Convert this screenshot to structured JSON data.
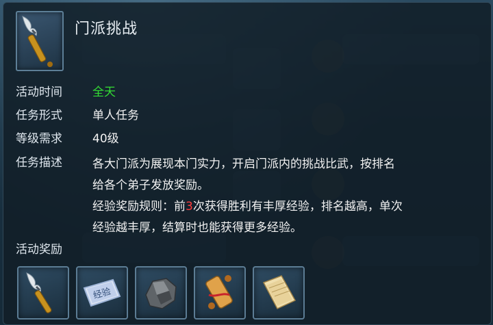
{
  "tooltip": {
    "title": "门派挑战",
    "icon": "spear-icon"
  },
  "info": {
    "time_label": "活动时间",
    "time_value": "全天",
    "form_label": "任务形式",
    "form_value": "单人任务",
    "level_label": "等级需求",
    "level_value": "40级",
    "desc_label": "任务描述",
    "desc_line1": "各大门派为展现本门实力，开启门派内的挑战比武，按排名",
    "desc_line2": "给各个弟子发放奖励。",
    "rule_prefix": "经验奖励规则：前",
    "rule_highlight": "3",
    "rule_suffix": "次获得胜利有丰厚经验，排名越高，单次",
    "rule_line2": "经验越丰厚，结算时也能获得更多经验。"
  },
  "rewards": {
    "label": "活动奖励",
    "items": [
      {
        "icon": "spear-icon"
      },
      {
        "icon": "experience-card-icon",
        "text": "经验"
      },
      {
        "icon": "ore-icon"
      },
      {
        "icon": "scroll-icon"
      },
      {
        "icon": "paper-book-icon"
      }
    ]
  },
  "colors": {
    "highlight_green": "#33dd33",
    "highlight_red": "#ff3b3b"
  }
}
